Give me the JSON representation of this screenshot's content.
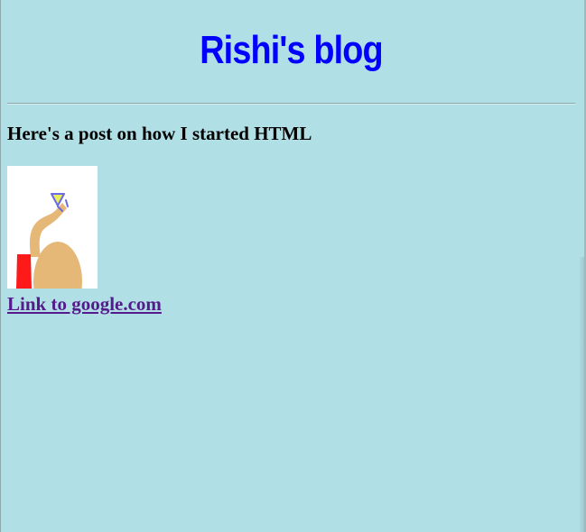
{
  "blog": {
    "title": "Rishi's blog",
    "post_heading": "Here's a post on how I started HTML",
    "link_text": "Link to google.com"
  },
  "colors": {
    "page_background": "#b0dfe5",
    "title_color": "#0000ff",
    "visited_link_color": "#551a8b"
  }
}
